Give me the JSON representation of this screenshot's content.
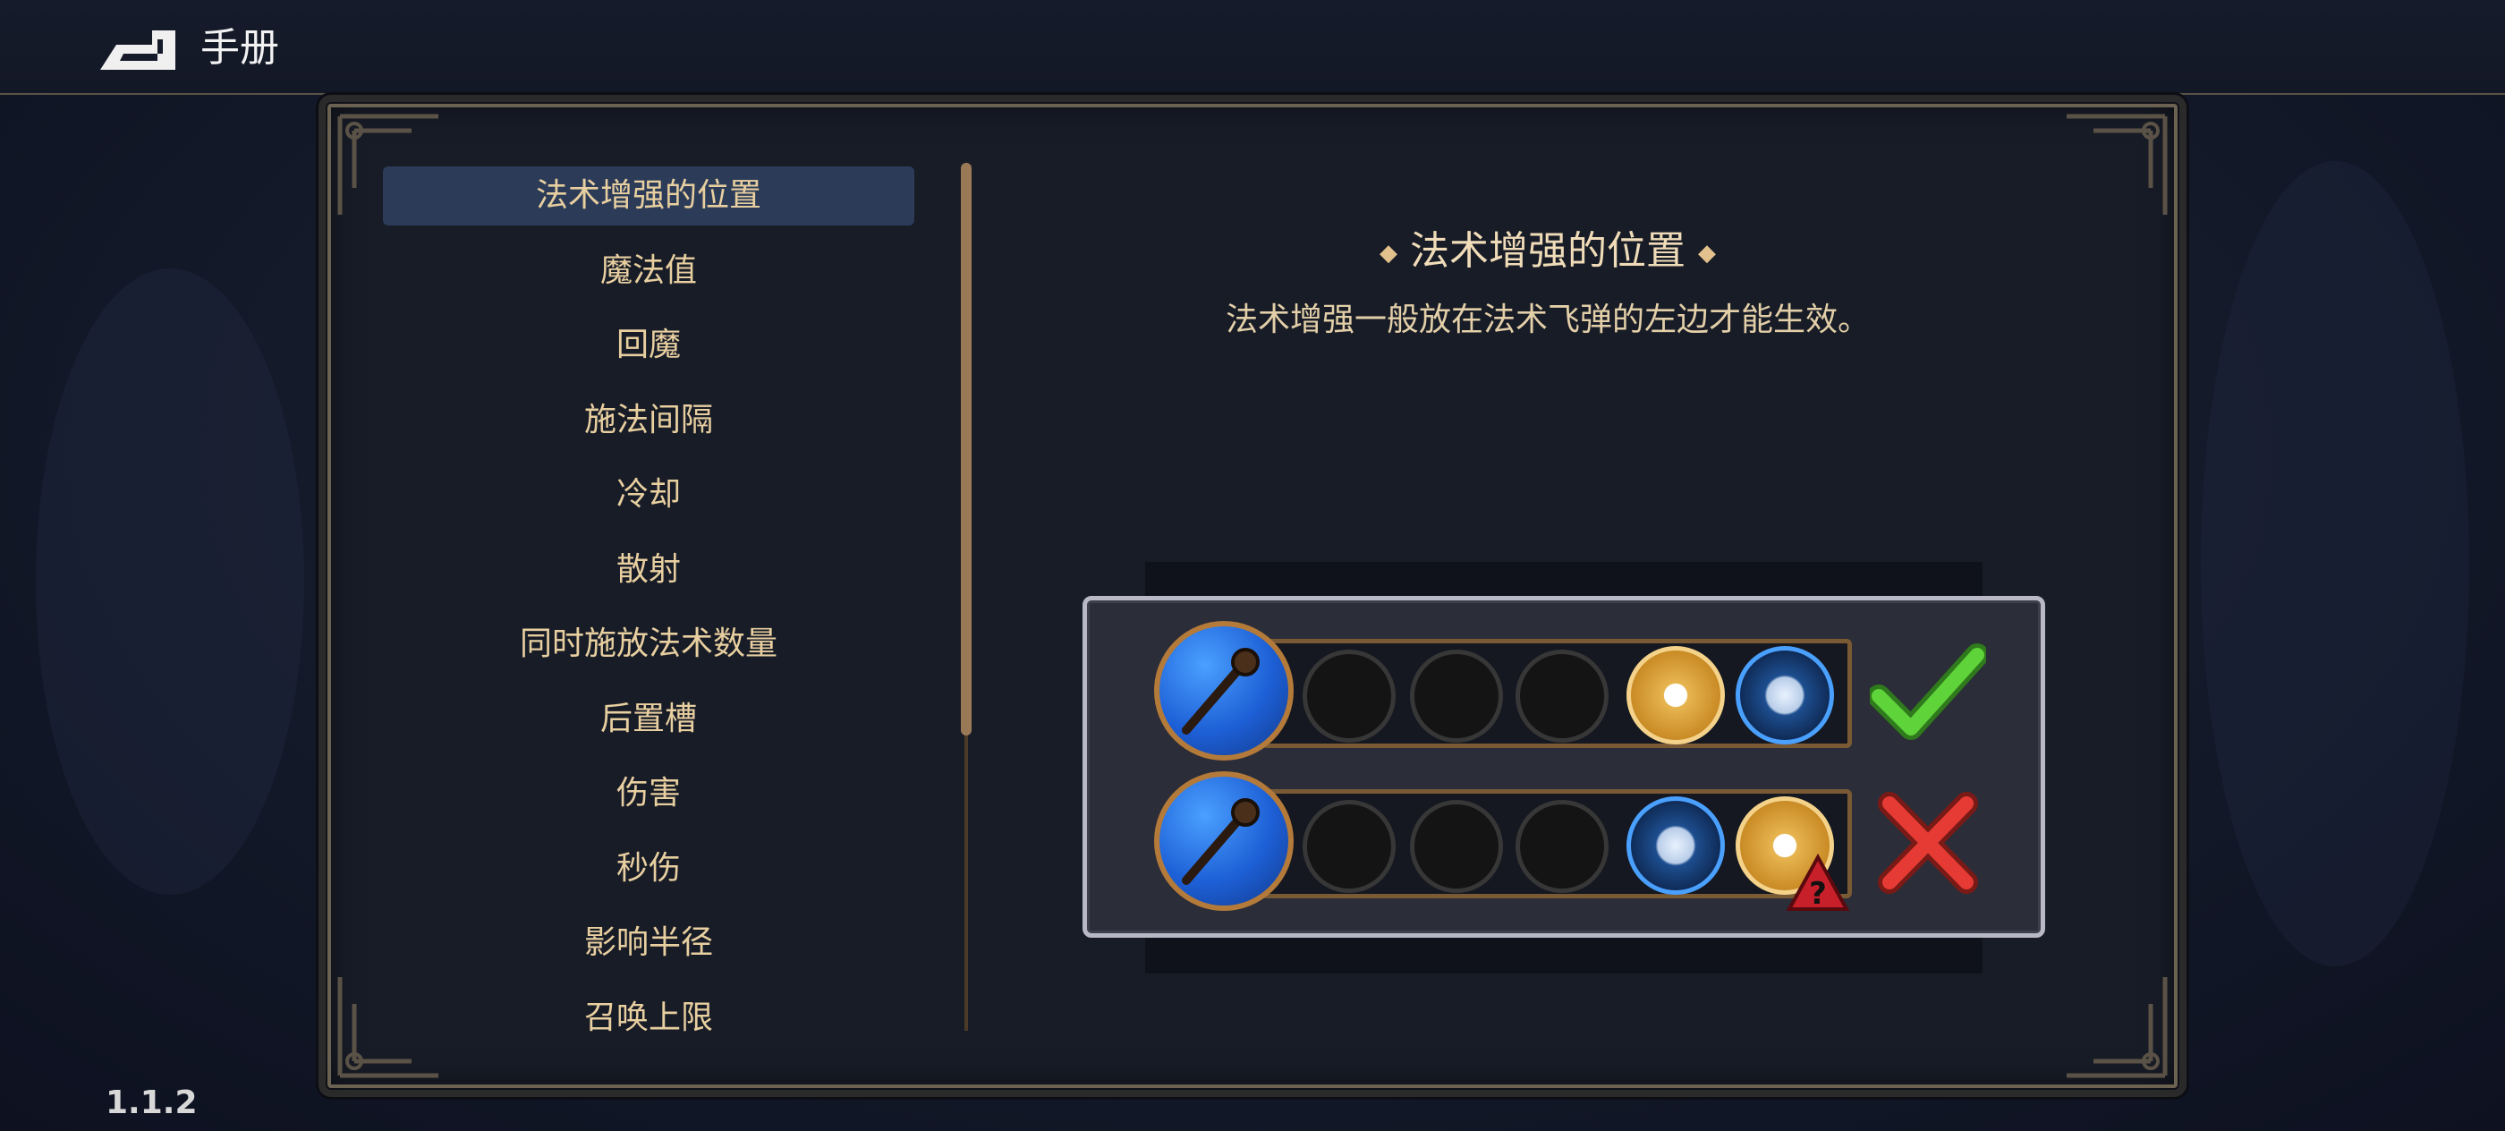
{
  "header": {
    "title": "手册"
  },
  "version": "1.1.2",
  "menu": {
    "items": [
      {
        "label": "法术增强的位置",
        "active": true
      },
      {
        "label": "魔法值"
      },
      {
        "label": "回魔"
      },
      {
        "label": "施法间隔"
      },
      {
        "label": "冷却"
      },
      {
        "label": "散射"
      },
      {
        "label": "同时施放法术数量"
      },
      {
        "label": "后置槽"
      },
      {
        "label": "伤害"
      },
      {
        "label": "秒伤"
      },
      {
        "label": "影响半径"
      },
      {
        "label": "召唤上限"
      }
    ]
  },
  "content": {
    "title": "法术增强的位置",
    "description": "法术增强一般放在法术飞弹的左边才能生效。"
  },
  "example": {
    "rows": [
      {
        "slots": [
          "empty",
          "empty",
          "empty",
          "modifier-gold",
          "projectile-blue"
        ],
        "result": "correct"
      },
      {
        "slots": [
          "empty",
          "empty",
          "empty",
          "projectile-blue",
          "modifier-gold-warning"
        ],
        "result": "incorrect"
      }
    ],
    "warning_text": "?"
  },
  "colors": {
    "accent": "#e8cfa0",
    "active_bg": "#2c3c58",
    "check": "#5fd33a",
    "cross": "#e53b34"
  }
}
